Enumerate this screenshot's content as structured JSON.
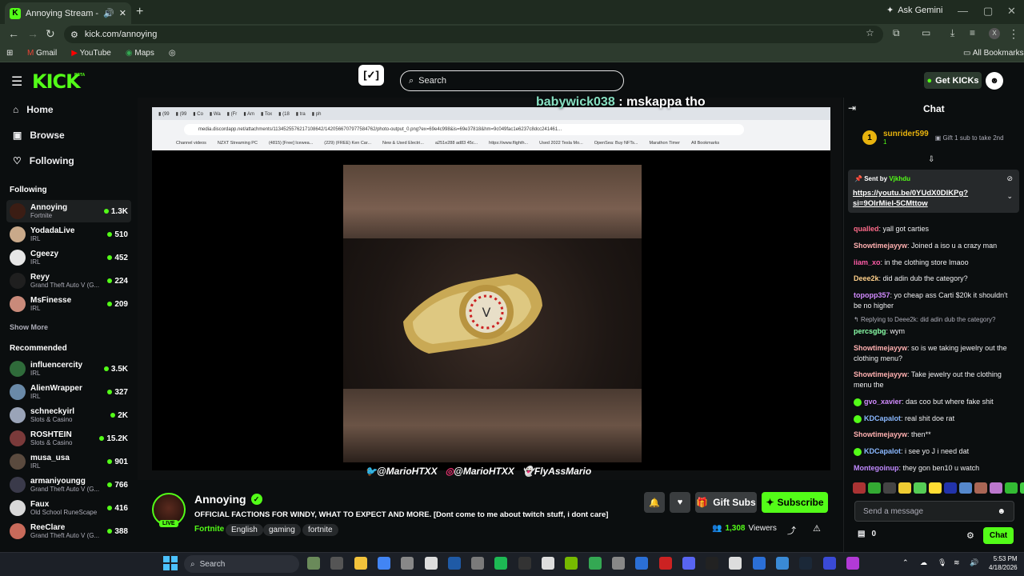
{
  "browser": {
    "tab_title": "Annoying Stream - Watch l",
    "url": "kick.com/annoying",
    "ask_gemini": "Ask Gemini",
    "bookmarks": [
      "Gmail",
      "YouTube",
      "Maps"
    ],
    "all_bookmarks": "All Bookmarks"
  },
  "header": {
    "logo": "KICK",
    "beta": "BETA",
    "search_placeholder": "Search",
    "get_kicks": "Get KICKs"
  },
  "sidebar": {
    "nav": [
      {
        "label": "Home",
        "icon": "home-icon"
      },
      {
        "label": "Browse",
        "icon": "browse-icon"
      },
      {
        "label": "Following",
        "icon": "heart-icon"
      }
    ],
    "following_heading": "Following",
    "following": [
      {
        "name": "Annoying",
        "category": "Fortnite",
        "viewers": "1.3K",
        "color": "#3b1d14"
      },
      {
        "name": "YodadaLive",
        "category": "IRL",
        "viewers": "510",
        "color": "#c9a98a"
      },
      {
        "name": "Cgeezy",
        "category": "IRL",
        "viewers": "452",
        "color": "#e6e6e6"
      },
      {
        "name": "Reyy",
        "category": "Grand Theft Auto V (G...",
        "viewers": "224",
        "color": "#1f1f1f"
      },
      {
        "name": "MsFinesse",
        "category": "IRL",
        "viewers": "209",
        "color": "#c98a7a"
      }
    ],
    "show_more": "Show More",
    "recommended_heading": "Recommended",
    "recommended": [
      {
        "name": "influencercity",
        "category": "IRL",
        "viewers": "3.5K",
        "color": "#2f6b3a"
      },
      {
        "name": "AlienWrapper",
        "category": "IRL",
        "viewers": "327",
        "color": "#6a8aa8"
      },
      {
        "name": "schneckyirl",
        "category": "Slots & Casino",
        "viewers": "2K",
        "color": "#9aa4b8"
      },
      {
        "name": "ROSHTEIN",
        "category": "Slots & Casino",
        "viewers": "15.2K",
        "color": "#7a3a3a"
      },
      {
        "name": "musa_usa",
        "category": "IRL",
        "viewers": "901",
        "color": "#5a4a3e"
      },
      {
        "name": "armaniyoungg",
        "category": "Grand Theft Auto V (G...",
        "viewers": "766",
        "color": "#3a3a4a"
      },
      {
        "name": "Faux",
        "category": "Old School RuneScape",
        "viewers": "416",
        "color": "#d8d8d8"
      },
      {
        "name": "ReeClare",
        "category": "Grand Theft Auto V (G...",
        "viewers": "388",
        "color": "#c86a5a"
      }
    ]
  },
  "player": {
    "overlay_user": "babywick038",
    "overlay_msg": ": mskappa tho",
    "inner_url": "media.discordapp.net/attachments/1134525576217108642/1420566707977584762/photo-output_0.png?ex=69e4c998&is=69e37818&hm=9c049fac1e6237c8dcc241461...",
    "inner_bookmarks": [
      "Channel videos",
      "NZXT Streaming PC",
      "(4815) [Free] Icewea...",
      "(229) (FREE) Ken Car...",
      "New & Used Electri...",
      "a251e288 ad83 45c...",
      "https://www.flighth...",
      "Used 2022 Tesla Mo...",
      "OpenSea: Buy NFTs...",
      "Marathon Timer",
      "All Bookmarks"
    ],
    "socials": [
      "@MarioHTXX",
      "@MarioHTXX",
      "FlyAssMario"
    ]
  },
  "stream": {
    "name": "Annoying",
    "live": "LIVE",
    "title": "OFFICIAL FACTIONS FOR WINDY, WHAT TO EXPECT AND MORE.  [Dont come to me about twitch stuff, i dont care]",
    "category": "Fortnite",
    "tags": [
      "English",
      "gaming",
      "fortnite"
    ],
    "gift_subs": "Gift Subs",
    "subscribe": "Subscribe",
    "viewers": "1,308",
    "viewers_label": "Viewers"
  },
  "chat": {
    "title": "Chat",
    "gifter": {
      "name": "sunrider599",
      "rank": "1",
      "note": "Gift 1 sub to take 2nd"
    },
    "pinned": {
      "by_label": "Sent by",
      "by_user": "Vjkhdu",
      "link": "https://youtu.be/0YUdX0DlKPg?si=9OlrMiel-5CMttow"
    },
    "messages": [
      {
        "user": "qualled",
        "color": "#ff6b8a",
        "text": "yall got carties",
        "badge": false
      },
      {
        "user": "Showtimejayyw",
        "color": "#ffb0b0",
        "text": "Joined a iso u a crazy man",
        "badge": false
      },
      {
        "user": "iiam_xo",
        "color": "#ff5ca8",
        "text": "in the clothing store lmaoo",
        "badge": false
      },
      {
        "user": "Deee2k",
        "color": "#ffd08a",
        "text": "did adin dub the category?",
        "badge": false
      },
      {
        "user": "topopp357",
        "color": "#d28bff",
        "text": "yo cheap ass Carti $20k it shouldn't be no higher",
        "badge": false
      },
      {
        "user": "percsgbg",
        "color": "#8affa8",
        "text": "wym",
        "badge": false
      },
      {
        "user": "Showtimejayyw",
        "color": "#ffb0b0",
        "text": "so is we taking jewelry out the clothing menu?",
        "badge": false
      },
      {
        "user": "Showtimejayyw",
        "color": "#ffb0b0",
        "text": "Take jewelry out the clothing menu the",
        "badge": false
      },
      {
        "user": "gvo_xavier",
        "color": "#d28bff",
        "text": "das coo but where fake shit",
        "badge": true
      },
      {
        "user": "KDCapalot",
        "color": "#8ab8ff",
        "text": "real shit doe rat",
        "badge": true
      },
      {
        "user": "Showtimejayyw",
        "color": "#ffb0b0",
        "text": "then**",
        "badge": false
      },
      {
        "user": "KDCapalot",
        "color": "#8ab8ff",
        "text": "i see yo J i need dat",
        "badge": true
      },
      {
        "user": "Montegoinup",
        "color": "#c08aff",
        "text": "they gon ben10 u watch",
        "badge": false
      }
    ],
    "reply_note": "Replying to Deee2k: did adin dub the category?",
    "input_placeholder": "Send a message",
    "kicks_count": "0",
    "send_label": "Chat"
  },
  "taskbar": {
    "search": "Search",
    "time": "5:53 PM",
    "date": "4/18/2026"
  }
}
